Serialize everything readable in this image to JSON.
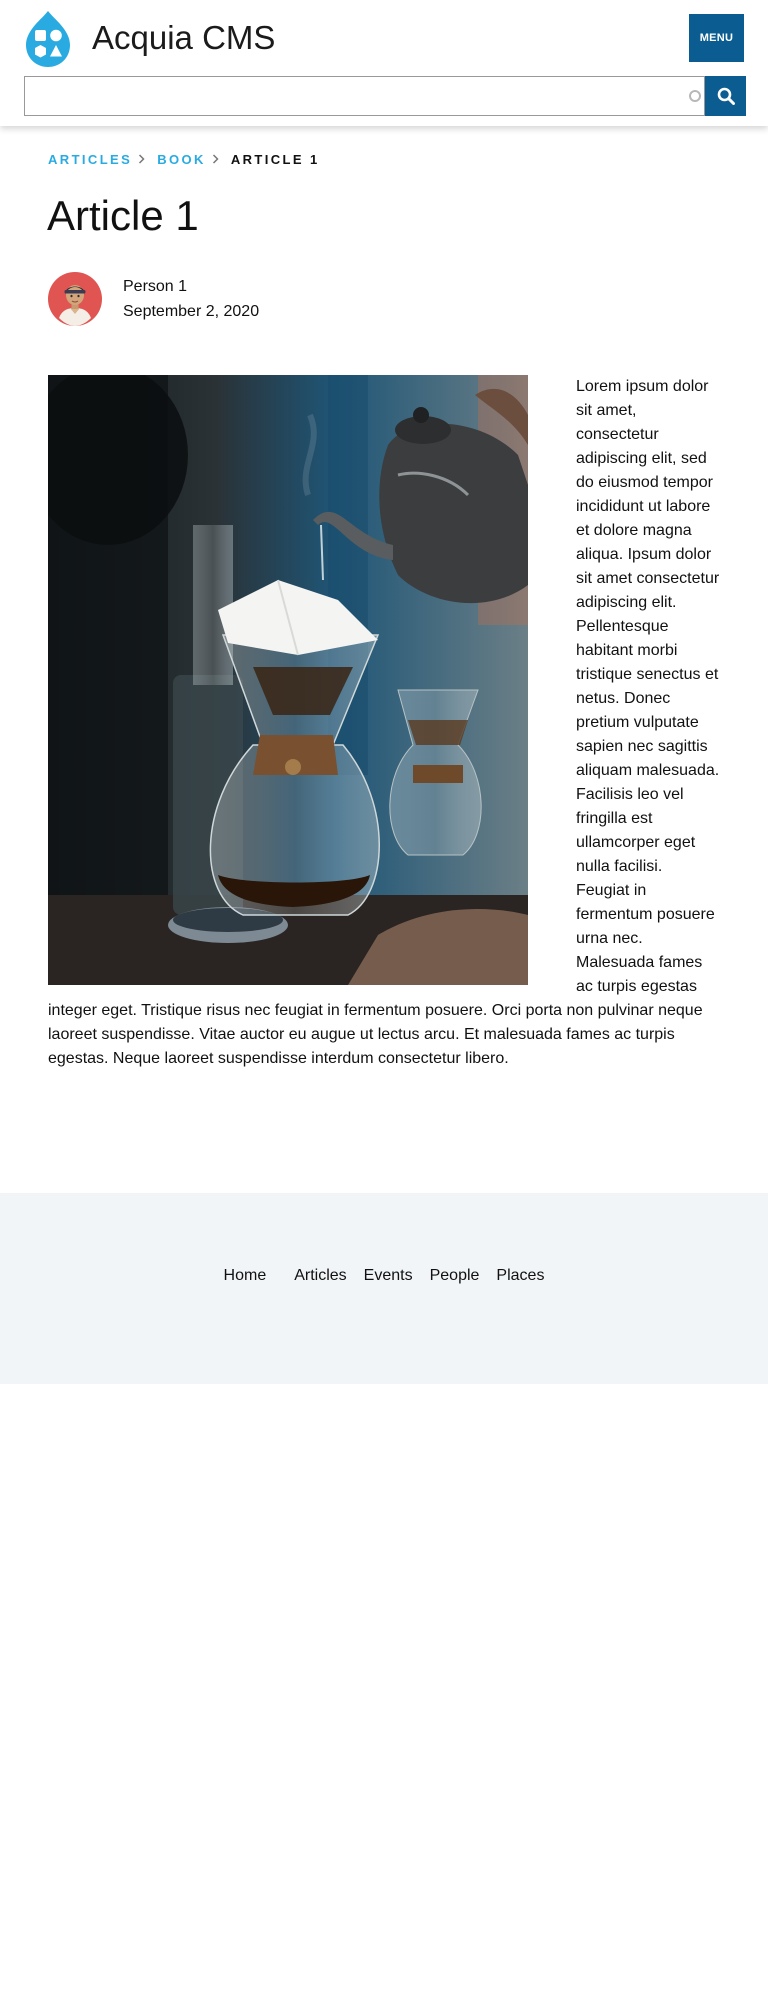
{
  "header": {
    "site_name": "Acquia CMS",
    "menu_label": "MENU",
    "search": {
      "value": "",
      "placeholder": ""
    },
    "logo_icon": "drupal-drop-icon",
    "search_icon": "magnifier-icon",
    "accent_color": "#0b5d91",
    "logo_color": "#29abe2"
  },
  "breadcrumb": {
    "items": [
      {
        "label": "ARTICLES"
      },
      {
        "label": "BOOK"
      }
    ],
    "current": "ARTICLE 1",
    "separator_icon": "chevron-right-icon",
    "link_color": "#29abe2"
  },
  "article": {
    "title": "Article 1",
    "author": "Person 1",
    "date": "September 2, 2020",
    "avatar_icon": "person-avatar-icon",
    "image_icon": "coffee-pour-over-photo",
    "body": "Lorem ipsum dolor sit amet, consectetur adipiscing elit, sed do eiusmod tempor incididunt ut labore et dolore magna aliqua. Ipsum dolor sit amet consectetur adipiscing elit. Pellentesque habitant morbi tristique senectus et netus. Donec pretium vulputate sapien nec sagittis aliquam malesuada. Facilisis leo vel fringilla est ullamcorper eget nulla facilisi. Feugiat in fermentum posuere urna nec. Malesuada fames ac turpis egestas integer eget. Tristique risus nec feugiat in fermentum posuere. Orci porta non pulvinar neque laoreet suspendisse. Vitae auctor eu augue ut lectus arcu. Et malesuada fames ac turpis egestas. Neque laoreet suspendisse interdum consectetur libero."
  },
  "footer": {
    "background": "#f2f5f8",
    "nav": {
      "home": "Home",
      "articles": "Articles",
      "events": "Events",
      "people": "People",
      "places": "Places"
    }
  }
}
